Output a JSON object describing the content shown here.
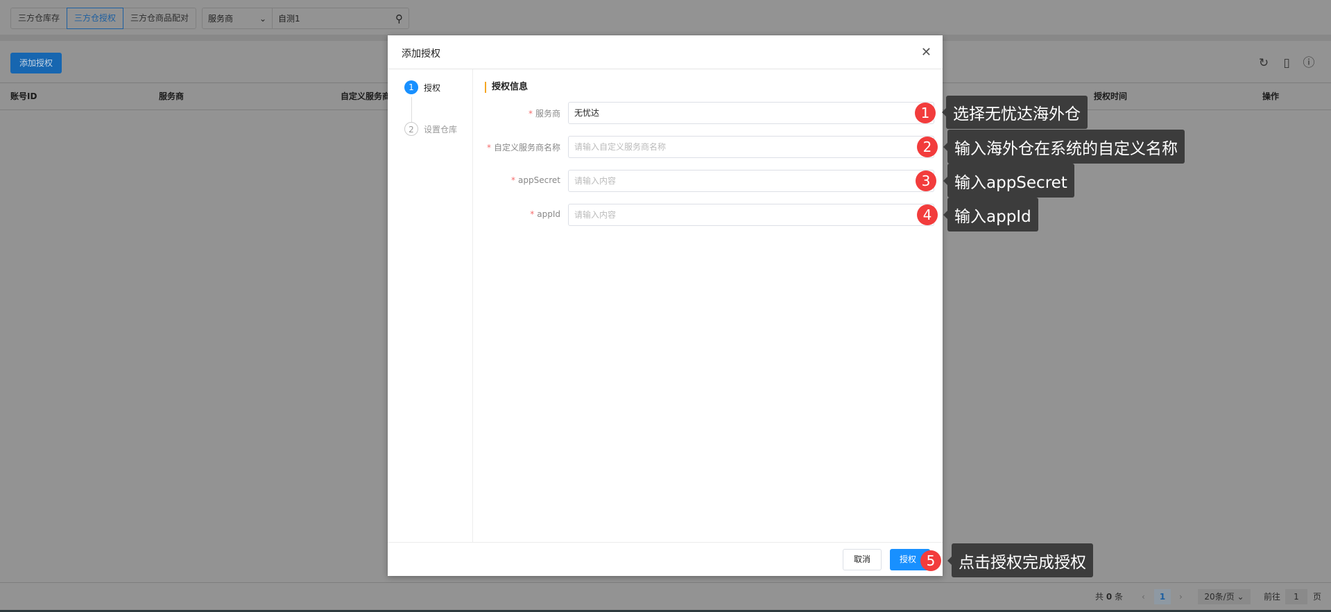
{
  "top_tabs": [
    {
      "label": "三方仓库存"
    },
    {
      "label": "三方仓授权",
      "active": true
    },
    {
      "label": "三方仓商品配对"
    }
  ],
  "filter": {
    "select_value": "服务商",
    "search_value": "自测1"
  },
  "toolbar": {
    "add_label": "添加授权",
    "icons": [
      "refresh-icon",
      "export-icon",
      "help-icon"
    ]
  },
  "table": {
    "columns": [
      "账号ID",
      "服务商",
      "自定义服务商",
      "授权时间",
      "操作"
    ]
  },
  "pagination": {
    "total_prefix": "共",
    "total": "0",
    "total_suffix": "条",
    "current_page": "1",
    "page_size": "20条/页",
    "goto_label": "前往",
    "goto_value": "1",
    "page_suffix": "页"
  },
  "modal": {
    "title": "添加授权",
    "steps": [
      {
        "num": "1",
        "label": "授权"
      },
      {
        "num": "2",
        "label": "设置仓库"
      }
    ],
    "section_title": "授权信息",
    "fields": [
      {
        "label": "服务商",
        "value": "无忧达",
        "placeholder": ""
      },
      {
        "label": "自定义服务商名称",
        "value": "",
        "placeholder": "请输入自定义服务商名称"
      },
      {
        "label": "appSecret",
        "value": "",
        "placeholder": "请输入内容"
      },
      {
        "label": "appId",
        "value": "",
        "placeholder": "请输入内容"
      }
    ],
    "cancel_label": "取消",
    "submit_label": "授权"
  },
  "annotations": [
    {
      "num": "1",
      "text": "选择无忧达海外仓"
    },
    {
      "num": "2",
      "text": "输入海外仓在系统的自定义名称"
    },
    {
      "num": "3",
      "text": "输入appSecret"
    },
    {
      "num": "4",
      "text": "输入appId"
    },
    {
      "num": "5",
      "text": "点击授权完成授权"
    }
  ],
  "colors": {
    "primary": "#1890ff",
    "badge": "#f23c3c",
    "tooltip": "#3c3c3c",
    "section_accent": "#f5a623"
  }
}
